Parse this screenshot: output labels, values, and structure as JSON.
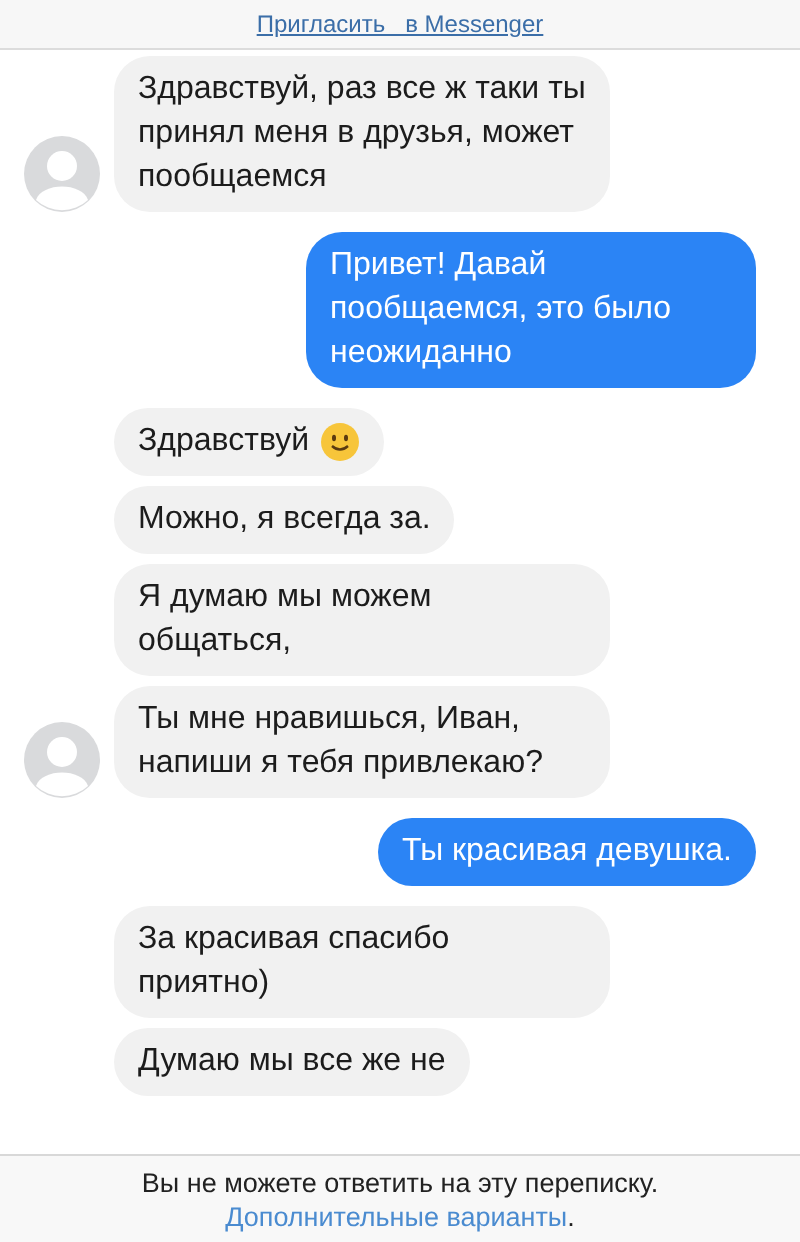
{
  "header": {
    "invite_link": "Пригласить   в Messenger"
  },
  "groups": [
    {
      "kind": "incoming",
      "messages": [
        {
          "kind": "text",
          "text": "Здравствуй, раз все ж таки ты принял меня в друзья, может пообщаемся"
        }
      ]
    },
    {
      "kind": "outgoing",
      "messages": [
        {
          "kind": "text",
          "text": "Привет! Давай пообщаемся, это было неожиданно"
        }
      ]
    },
    {
      "kind": "incoming",
      "messages": [
        {
          "kind": "text_emoji",
          "text": "Здравствуй"
        },
        {
          "kind": "text",
          "text": "Можно, я всегда за."
        },
        {
          "kind": "text",
          "text": "Я думаю мы можем общаться,"
        },
        {
          "kind": "text",
          "text": "Ты мне нравишься, Иван, напиши я тебя привлекаю?"
        }
      ]
    },
    {
      "kind": "outgoing",
      "messages": [
        {
          "kind": "text",
          "text": "Ты красивая девушка."
        }
      ]
    },
    {
      "kind": "incoming",
      "messages": [
        {
          "kind": "text",
          "text": "За красивая спасибо приятно)"
        },
        {
          "kind": "text",
          "text": "Думаю мы все же не"
        }
      ]
    }
  ],
  "footer": {
    "notice": "Вы не можете ответить на эту переписку.",
    "link": "Дополнительные варианты",
    "link_suffix": "."
  }
}
